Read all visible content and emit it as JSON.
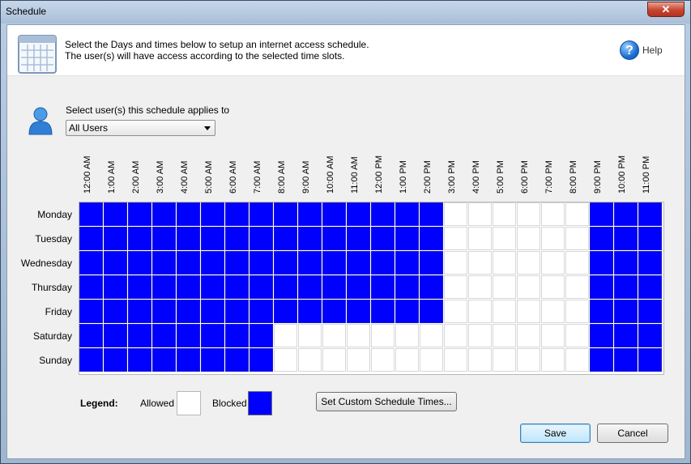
{
  "window": {
    "title": "Schedule",
    "close_label": "✕"
  },
  "header": {
    "line1": "Select the Days and times below to setup an internet access schedule.",
    "line2": "The user(s) will have access according to the selected time slots.",
    "help_label": "Help",
    "help_glyph": "?"
  },
  "users": {
    "label": "Select user(s) this schedule applies to",
    "selected": "All Users"
  },
  "schedule": {
    "times": [
      "12:00 AM",
      "1:00 AM",
      "2:00 AM",
      "3:00 AM",
      "4:00 AM",
      "5:00 AM",
      "6:00 AM",
      "7:00 AM",
      "8:00 AM",
      "9:00 AM",
      "10:00 AM",
      "11:00 AM",
      "12:00 PM",
      "1:00 PM",
      "2:00 PM",
      "3:00 PM",
      "4:00 PM",
      "5:00 PM",
      "6:00 PM",
      "7:00 PM",
      "8:00 PM",
      "9:00 PM",
      "10:00 PM",
      "11:00 PM"
    ],
    "days": [
      {
        "name": "Monday",
        "blocked": [
          1,
          1,
          1,
          1,
          1,
          1,
          1,
          1,
          1,
          1,
          1,
          1,
          1,
          1,
          1,
          0,
          0,
          0,
          0,
          0,
          0,
          1,
          1,
          1
        ]
      },
      {
        "name": "Tuesday",
        "blocked": [
          1,
          1,
          1,
          1,
          1,
          1,
          1,
          1,
          1,
          1,
          1,
          1,
          1,
          1,
          1,
          0,
          0,
          0,
          0,
          0,
          0,
          1,
          1,
          1
        ]
      },
      {
        "name": "Wednesday",
        "blocked": [
          1,
          1,
          1,
          1,
          1,
          1,
          1,
          1,
          1,
          1,
          1,
          1,
          1,
          1,
          1,
          0,
          0,
          0,
          0,
          0,
          0,
          1,
          1,
          1
        ]
      },
      {
        "name": "Thursday",
        "blocked": [
          1,
          1,
          1,
          1,
          1,
          1,
          1,
          1,
          1,
          1,
          1,
          1,
          1,
          1,
          1,
          0,
          0,
          0,
          0,
          0,
          0,
          1,
          1,
          1
        ]
      },
      {
        "name": "Friday",
        "blocked": [
          1,
          1,
          1,
          1,
          1,
          1,
          1,
          1,
          1,
          1,
          1,
          1,
          1,
          1,
          1,
          0,
          0,
          0,
          0,
          0,
          0,
          1,
          1,
          1
        ]
      },
      {
        "name": "Saturday",
        "blocked": [
          1,
          1,
          1,
          1,
          1,
          1,
          1,
          1,
          0,
          0,
          0,
          0,
          0,
          0,
          0,
          0,
          0,
          0,
          0,
          0,
          0,
          1,
          1,
          1
        ]
      },
      {
        "name": "Sunday",
        "blocked": [
          1,
          1,
          1,
          1,
          1,
          1,
          1,
          1,
          0,
          0,
          0,
          0,
          0,
          0,
          0,
          0,
          0,
          0,
          0,
          0,
          0,
          1,
          1,
          1
        ]
      }
    ],
    "colors": {
      "blocked": "#0000ff",
      "allowed": "#ffffff"
    }
  },
  "legend": {
    "title": "Legend:",
    "allowed": "Allowed",
    "blocked": "Blocked"
  },
  "buttons": {
    "custom": "Set Custom Schedule Times...",
    "save": "Save",
    "cancel": "Cancel"
  }
}
